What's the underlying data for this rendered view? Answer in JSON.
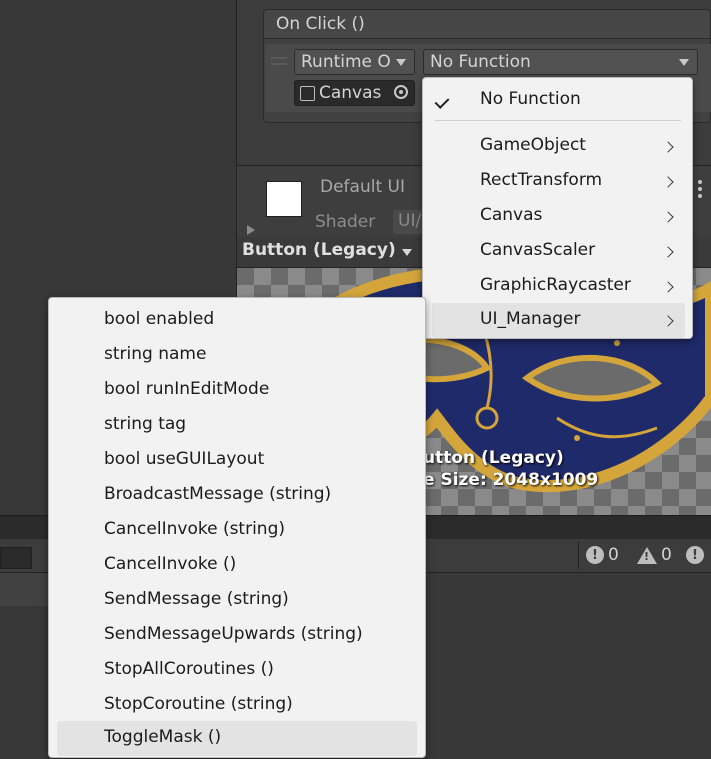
{
  "event": {
    "title": "On Click ()",
    "runtime_dropdown": "Runtime O",
    "function_dropdown": "No Function",
    "target_object": "Canvas"
  },
  "material": {
    "name": "Default UI",
    "shader_label": "Shader",
    "shader_value": "UI/"
  },
  "preview": {
    "dropdown": "Button (Legacy)",
    "caption_line1": "utton (Legacy)",
    "caption_line2": "e Size: 2048x1009"
  },
  "console": {
    "error_count": "0",
    "warning_count": "0"
  },
  "component_menu": {
    "items": [
      {
        "label": "No Function",
        "checked": true
      },
      {
        "label": "GameObject"
      },
      {
        "label": "RectTransform"
      },
      {
        "label": "Canvas"
      },
      {
        "label": "CanvasScaler"
      },
      {
        "label": "GraphicRaycaster"
      },
      {
        "label": "UI_Manager",
        "highlighted": true
      }
    ]
  },
  "method_menu": {
    "items": [
      "bool enabled",
      "string name",
      "bool runInEditMode",
      "string tag",
      "bool useGUILayout",
      "BroadcastMessage (string)",
      "CancelInvoke (string)",
      "CancelInvoke ()",
      "SendMessage (string)",
      "SendMessageUpwards (string)",
      "StopAllCoroutines ()",
      "StopCoroutine (string)",
      "ToggleMask ()"
    ],
    "highlighted_index": 12
  },
  "colors": {
    "editor_bg": "#383838",
    "menu_bg": "#f2f2f2",
    "menu_highlight": "#e3e3e3",
    "mask_navy": "#1f2a6b",
    "mask_gold": "#d4a53a"
  }
}
